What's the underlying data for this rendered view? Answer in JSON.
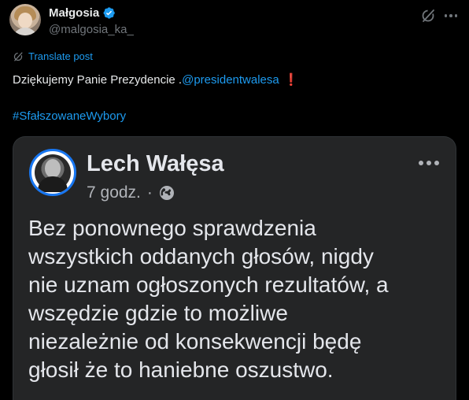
{
  "author": {
    "display_name": "Małgosia",
    "handle": "@malgosia_ka_"
  },
  "icons": {
    "verified": "verified-badge-icon",
    "grok": "grok-icon",
    "more": "more-options-icon",
    "translate": "translate-icon",
    "globe": "globe-icon"
  },
  "translate_label": "Translate post",
  "tweet": {
    "text_prefix": "Dziękujemy Panie Prezydencie .",
    "mention": "@presidentwalesa",
    "exclamation": "❗",
    "hashtag": "#SfałszowaneWybory"
  },
  "embedded_post": {
    "author_name": "Lech Wałęsa",
    "time": "7 godz.",
    "separator": "·",
    "text": "Bez ponownego sprawdzenia\nwszystkich oddanych głosów,  nigdy\nnie uznam  ogłoszonych rezultatów, a\nwszędzie gdzie to możliwe\nniezależnie od konsekwencji będę\ngłosił że to haniebne oszustwo."
  },
  "colors": {
    "background": "#000000",
    "link": "#1d9bf0",
    "muted": "#71767b",
    "fb_card": "#242526",
    "fb_accent": "#1877f2"
  }
}
